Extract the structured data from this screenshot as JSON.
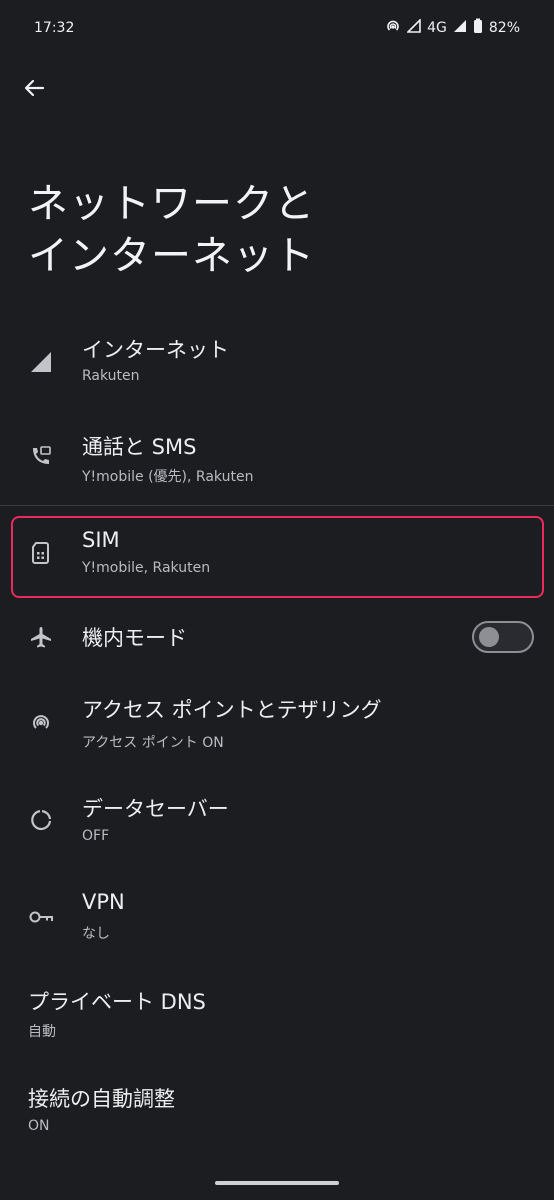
{
  "status": {
    "time": "17:32",
    "network": "4G",
    "battery": "82%"
  },
  "page": {
    "title_line1": "ネットワークと",
    "title_line2": "インターネット"
  },
  "items": [
    {
      "label": "インターネット",
      "sub": "Rakuten",
      "icon": "signal-icon"
    },
    {
      "label": "通話と SMS",
      "sub": "Y!mobile (優先), Rakuten",
      "icon": "phone-sms-icon"
    },
    {
      "label": "SIM",
      "sub": "Y!mobile, Rakuten",
      "icon": "sim-card-icon"
    },
    {
      "label": "機内モード",
      "icon": "airplane-icon",
      "toggle": "off"
    },
    {
      "label": "アクセス ポイントとテザリング",
      "sub": "アクセス ポイント ON",
      "icon": "hotspot-icon"
    },
    {
      "label": "データセーバー",
      "sub": "OFF",
      "icon": "data-saver-icon"
    },
    {
      "label": "VPN",
      "sub": "なし",
      "icon": "vpn-key-icon"
    },
    {
      "label": "プライベート DNS",
      "sub": "自動"
    },
    {
      "label": "接続の自動調整",
      "sub": "ON"
    }
  ],
  "colors": {
    "background": "#1c1d21",
    "highlight": "#ea2a5c"
  }
}
